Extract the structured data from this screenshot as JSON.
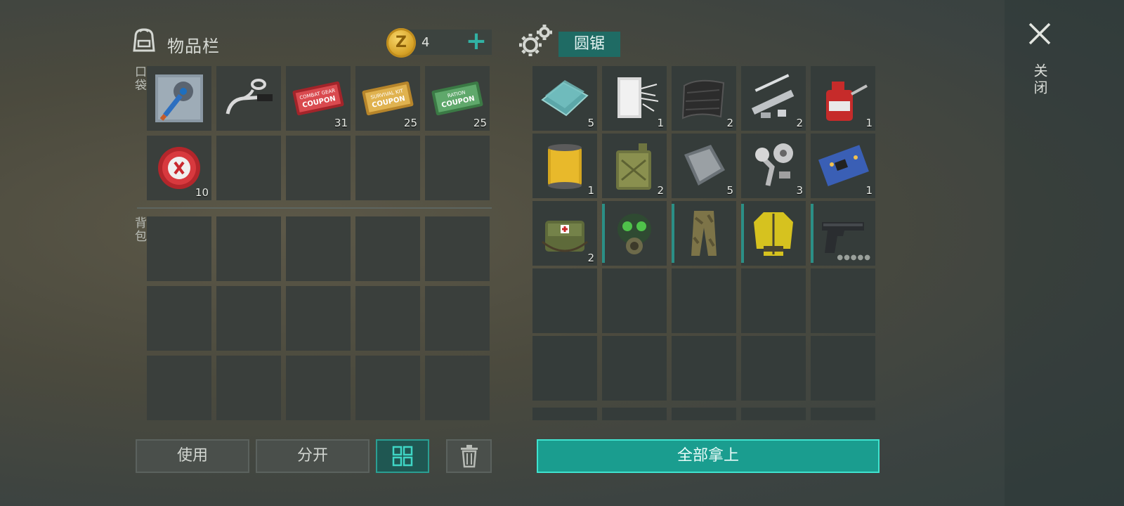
{
  "inventory": {
    "title": "物品栏",
    "coins": "4",
    "coin_symbol": "Z",
    "pocket_label": "口袋",
    "backpack_label": "背包",
    "pocket_slots": [
      {
        "icon": "blueprint-saw-icon",
        "count": ""
      },
      {
        "icon": "handlebar-icon",
        "count": ""
      },
      {
        "icon": "combat-gear-coupon-icon",
        "count": "31",
        "coupon_text": "COMBAT GEAR",
        "coupon_sub": "COUPON"
      },
      {
        "icon": "survival-kit-coupon-icon",
        "count": "25",
        "coupon_text": "SURVIVAL KIT",
        "coupon_sub": "COUPON"
      },
      {
        "icon": "ration-coupon-icon",
        "count": "25",
        "coupon_text": "RATION",
        "coupon_sub": "COUPON"
      },
      {
        "icon": "bottle-cap-icon",
        "count": "10"
      },
      {
        "icon": "",
        "count": ""
      },
      {
        "icon": "",
        "count": ""
      },
      {
        "icon": "",
        "count": ""
      },
      {
        "icon": "",
        "count": ""
      }
    ],
    "buttons": {
      "use": "使用",
      "split": "分开"
    }
  },
  "crafting": {
    "title": "圆锯",
    "slots": [
      {
        "icon": "glass-sheets-icon",
        "count": "5"
      },
      {
        "icon": "fiberglass-icon",
        "count": "1"
      },
      {
        "icon": "carbon-fabric-icon",
        "count": "2"
      },
      {
        "icon": "metal-pipe-parts-icon",
        "count": "2"
      },
      {
        "icon": "oil-can-icon",
        "count": "1"
      },
      {
        "icon": "oil-filter-icon",
        "count": "1"
      },
      {
        "icon": "jerrycan-icon",
        "count": "2"
      },
      {
        "icon": "metal-plate-icon",
        "count": "5"
      },
      {
        "icon": "engine-parts-icon",
        "count": "3"
      },
      {
        "icon": "circuit-board-icon",
        "count": "1"
      },
      {
        "icon": "medical-bag-icon",
        "count": "2"
      },
      {
        "icon": "gas-mask-icon",
        "count": "",
        "equip": true
      },
      {
        "icon": "camo-pants-icon",
        "count": "",
        "equip": true
      },
      {
        "icon": "yellow-jacket-icon",
        "count": "",
        "equip": true
      },
      {
        "icon": "pistol-icon",
        "count": "",
        "equip": true,
        "dots": "●●●●●"
      }
    ],
    "take_all": "全部拿上"
  },
  "close_label": "关闭",
  "colors": {
    "accent": "#1a9d8f",
    "accent_border": "#3fe3cf",
    "slot": "#3a3f3c"
  }
}
